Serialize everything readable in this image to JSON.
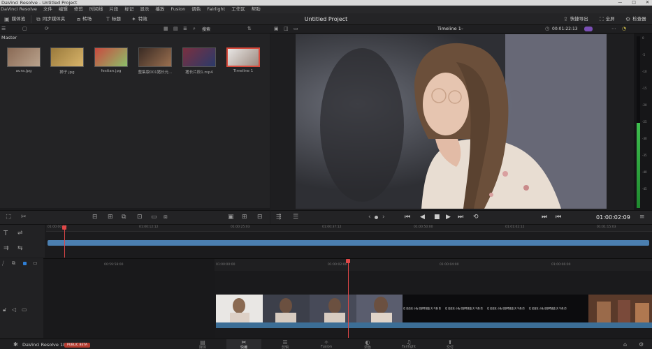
{
  "window": {
    "title": "DaVinci Resolve - Untitled Project",
    "controls": [
      "—",
      "□",
      "✕"
    ]
  },
  "menu": [
    "DaVinci Resolve",
    "文件",
    "编辑",
    "修剪",
    "时间线",
    "片段",
    "标记",
    "显示",
    "播放",
    "Fusion",
    "调色",
    "Fairlight",
    "工作区",
    "帮助"
  ],
  "toolbar": {
    "media_pool": "媒体池",
    "sync_bin": "同步媒体夹",
    "transitions": "转场",
    "titles": "标题",
    "effects": "特效",
    "project_title": "Untitled Project",
    "quick_export": "快捷导出",
    "fullscreen": "全屏",
    "inspector": "检查器"
  },
  "subbar": {
    "search": "搜索",
    "timeline_name": "Timeline 1",
    "timecode": "00:01:22:13"
  },
  "pool": {
    "bin": "Master",
    "clips": [
      {
        "name": "aura.jpg",
        "c1": "#8a6a55",
        "c2": "#b9a28c"
      },
      {
        "name": "狮子.jpg",
        "c1": "#9a7a3c",
        "c2": "#d8b46a"
      },
      {
        "name": "festian.jpg",
        "c1": "#c94a3f",
        "c2": "#8cbf6a"
      },
      {
        "name": "整集版001猪长元...",
        "c1": "#3a2b24",
        "c2": "#9b7050"
      },
      {
        "name": "猪长片段1.mp4",
        "c1": "#7a3040",
        "c2": "#2a3a6a"
      },
      {
        "name": "Timeline 1",
        "c1": "#e8e6e4",
        "c2": "#9c8a80"
      }
    ]
  },
  "transport": {
    "timecode": "01:00:02:09"
  },
  "ruler_upper": [
    "01:00:00:00",
    "01:00:12:12",
    "01:00:25:03",
    "01:00:37:12",
    "01:00:50:00",
    "01:01:02:12",
    "01:01:15:03"
  ],
  "ruler_lower": [
    "00:59:58:00",
    "01:00:00:00",
    "01:00:02:00",
    "01:00:04:00",
    "01:00:06:00"
  ],
  "meter_scale": [
    "0",
    "-5",
    "-10",
    "-15",
    "-20",
    "-25",
    "-30",
    "-35",
    "-40",
    "-45"
  ],
  "subtitle_text": "在 尼西克 小兔 但钢琴键盘 天 气像 的 ",
  "bottom": {
    "app": "DaVinci Resolve 18",
    "beta": "PUBLIC BETA",
    "pages": [
      {
        "icon": "▤",
        "label": "媒体"
      },
      {
        "icon": "✂",
        "label": "快编"
      },
      {
        "icon": "☰",
        "label": "剪辑"
      },
      {
        "icon": "✧",
        "label": "Fusion"
      },
      {
        "icon": "◐",
        "label": "调色"
      },
      {
        "icon": "♫",
        "label": "Fairlight"
      },
      {
        "icon": "⬆",
        "label": "交付"
      }
    ]
  }
}
